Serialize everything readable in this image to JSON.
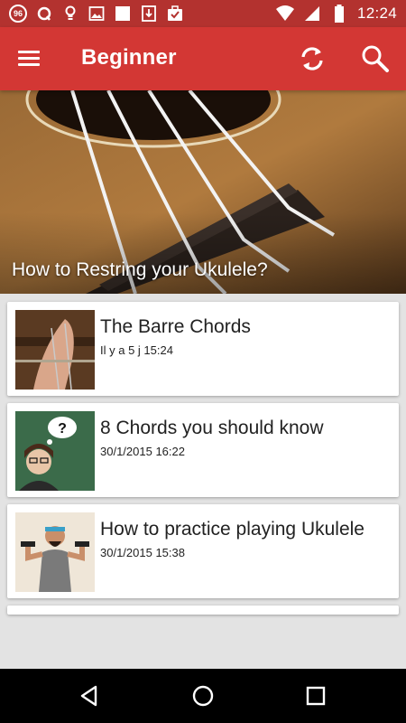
{
  "status_bar": {
    "notification_badge": "96",
    "icons_left": [
      "notification-badge-icon",
      "sync-arrow-icon",
      "lightbulb-icon",
      "image-icon",
      "checkbox-icon",
      "download-icon",
      "briefcase-check-icon"
    ],
    "icons_right": [
      "wifi-icon",
      "signal-icon",
      "battery-icon"
    ],
    "time": "12:24"
  },
  "app_bar": {
    "title": "Beginner",
    "color": "#d33734",
    "icons": [
      "menu-icon",
      "refresh-icon",
      "search-icon"
    ]
  },
  "hero": {
    "title": "How to Restring your Ukulele?"
  },
  "articles": [
    {
      "title": "The Barre Chords",
      "date": "Il y a 5 j 15:24"
    },
    {
      "title": "8 Chords you should know",
      "date": "30/1/2015 16:22"
    },
    {
      "title": "How to practice playing Ukulele",
      "date": "30/1/2015 15:38"
    }
  ],
  "nav_bar": {
    "icons": [
      "back-icon",
      "home-icon",
      "recents-icon"
    ]
  }
}
